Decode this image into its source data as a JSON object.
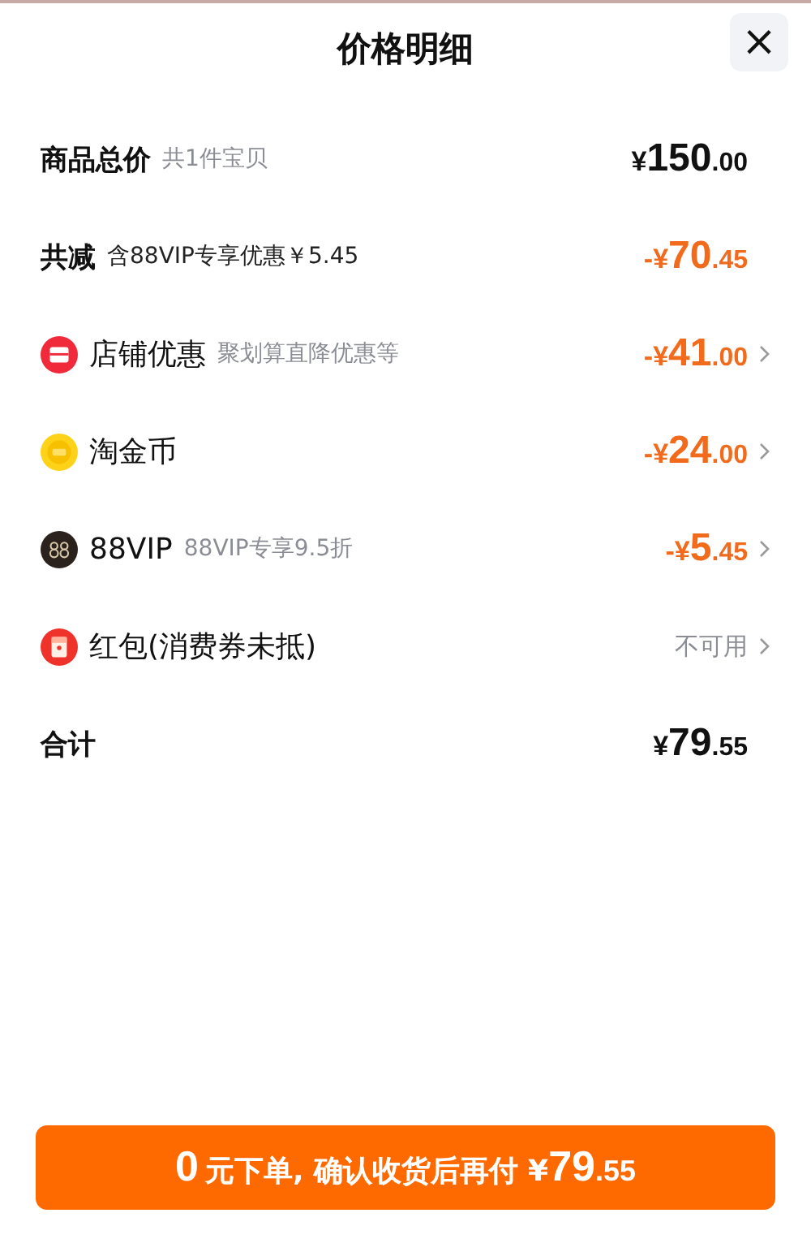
{
  "title": "价格明细",
  "close": "×",
  "rows": [
    {
      "kind": "plain",
      "label": "商品总价",
      "note": "共1件宝贝",
      "amount": {
        "currency": "¥",
        "main": "150",
        "cents": ".00"
      },
      "discount": false,
      "arrow": false
    },
    {
      "kind": "plain",
      "label": "共减",
      "note": "含88VIP专享优惠￥5.45",
      "amount": {
        "currency": "-¥",
        "main": "70",
        "cents": ".45"
      },
      "discount": true,
      "arrow": false
    },
    {
      "kind": "shop",
      "label": "店铺优惠",
      "note": "聚划算直降优惠等",
      "amount": {
        "currency": "-¥",
        "main": "41",
        "cents": ".00"
      },
      "discount": true,
      "arrow": true
    },
    {
      "kind": "coin",
      "label": "淘金币",
      "amount": {
        "currency": "-¥",
        "main": "24",
        "cents": ".00"
      },
      "discount": true,
      "arrow": true
    },
    {
      "kind": "vip",
      "label": "88VIP",
      "note": "88VIP专享9.5折",
      "amount": {
        "currency": "-¥",
        "main": "5",
        "cents": ".45"
      },
      "discount": true,
      "arrow": true
    },
    {
      "kind": "packet",
      "label": "红包(消费券未抵)",
      "status": "不可用",
      "arrow": true
    },
    {
      "kind": "plain",
      "label": "合计",
      "amount": {
        "currency": "¥",
        "main": "79",
        "cents": ".55"
      },
      "discount": false,
      "arrow": false
    }
  ],
  "button": {
    "lead": "0",
    "text": "元下单, 确认收货后再付",
    "currency": "¥",
    "main": "79",
    "cents": ".55"
  }
}
